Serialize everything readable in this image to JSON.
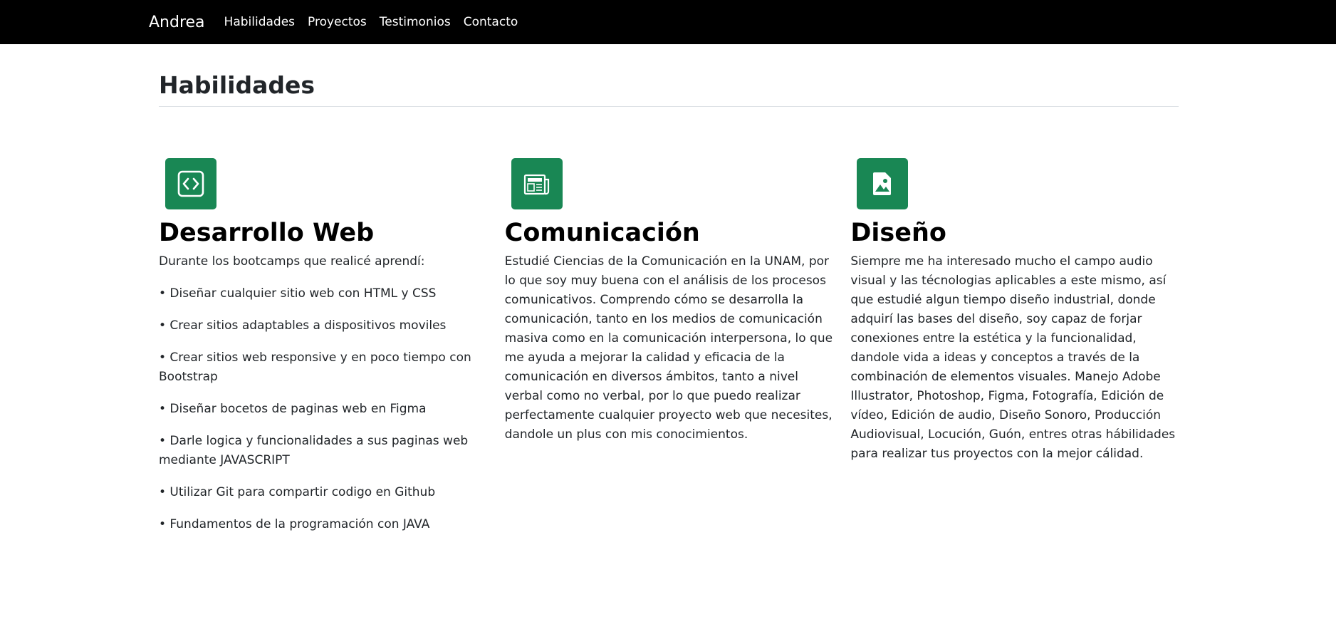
{
  "navbar": {
    "brand": "Andrea",
    "links": [
      "Habilidades",
      "Proyectos",
      "Testimonios",
      "Contacto"
    ]
  },
  "section": {
    "title": "Habilidades"
  },
  "features": [
    {
      "icon": "code-icon",
      "title": "Desarrollo Web",
      "paragraphs": [
        "Durante los bootcamps que realicé aprendí:",
        "• Diseñar cualquier sitio web con HTML y CSS",
        "• Crear sitios adaptables a dispositivos moviles",
        "• Crear sitios web responsive y en poco tiempo con Bootstrap",
        "• Diseñar bocetos de paginas web en Figma",
        "• Darle logica y funcionalidades a sus paginas web mediante JAVASCRIPT",
        "• Utilizar Git para compartir codigo en Github",
        "• Fundamentos de la programación con JAVA"
      ]
    },
    {
      "icon": "newspaper-icon",
      "title": "Comunicación",
      "paragraphs": [
        "Estudié Ciencias de la Comunicación en la UNAM, por lo que soy muy buena con el análisis de los procesos comunicativos. Comprendo cómo se desarrolla la comunicación, tanto en los medios de comunicación masiva como en la comunicación interpersona, lo que me ayuda a mejorar la calidad y eficacia de la comunicación en diversos ámbitos, tanto a nivel verbal como no verbal, por lo que puedo realizar perfectamente cualquier proyecto web que necesites, dandole un plus con mis conocimientos."
      ]
    },
    {
      "icon": "image-file-icon",
      "title": "Diseño",
      "paragraphs": [
        "Siempre me ha interesado mucho el campo audio visual y las técnologias aplicables a este mismo, así que estudié algun tiempo diseño industrial, donde adquirí las bases del diseño, soy capaz de forjar conexiones entre la estética y la funcionalidad, dandole vida a ideas y conceptos a través de la combinación de elementos visuales. Manejo Adobe Illustrator, Photoshop, Figma, Fotografía, Edición de vídeo, Edición de audio, Diseño Sonoro, Producción Audiovisual, Locución, Guón, entres otras hábilidades para realizar tus proyectos con la mejor cálidad."
      ]
    }
  ],
  "colors": {
    "navbar_bg": "#000000",
    "icon_bg": "#198754",
    "text": "#212529"
  }
}
